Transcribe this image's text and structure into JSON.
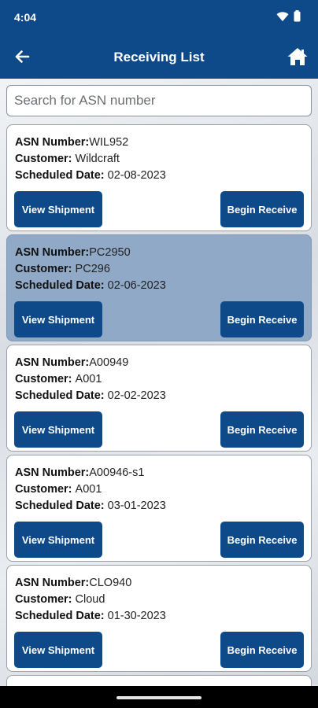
{
  "status": {
    "time": "4:04"
  },
  "appbar": {
    "title": "Receiving List"
  },
  "search": {
    "placeholder": "Search for ASN number",
    "value": ""
  },
  "labels": {
    "asn": "ASN Number:",
    "customer": "Customer: ",
    "date": "Scheduled Date: ",
    "view_button": "View Shipment",
    "begin_button": "Begin Receive"
  },
  "shipments": [
    {
      "asn": "WIL952",
      "customer": "Wildcraft",
      "date": "02-08-2023",
      "selected": false
    },
    {
      "asn": "PC2950",
      "customer": "PC296",
      "date": "02-06-2023",
      "selected": true
    },
    {
      "asn": "A00949",
      "customer": "A001",
      "date": "02-02-2023",
      "selected": false
    },
    {
      "asn": "A00946-s1",
      "customer": "A001",
      "date": "03-01-2023",
      "selected": false
    },
    {
      "asn": "CLO940",
      "customer": "Cloud",
      "date": "01-30-2023",
      "selected": false
    }
  ],
  "colors": {
    "primary": "#0e4a8a",
    "selected_card": "#8fa9c6"
  },
  "icons": {
    "back": "arrow-left-icon",
    "home": "home-icon",
    "wifi": "wifi-icon",
    "battery": "battery-icon"
  }
}
